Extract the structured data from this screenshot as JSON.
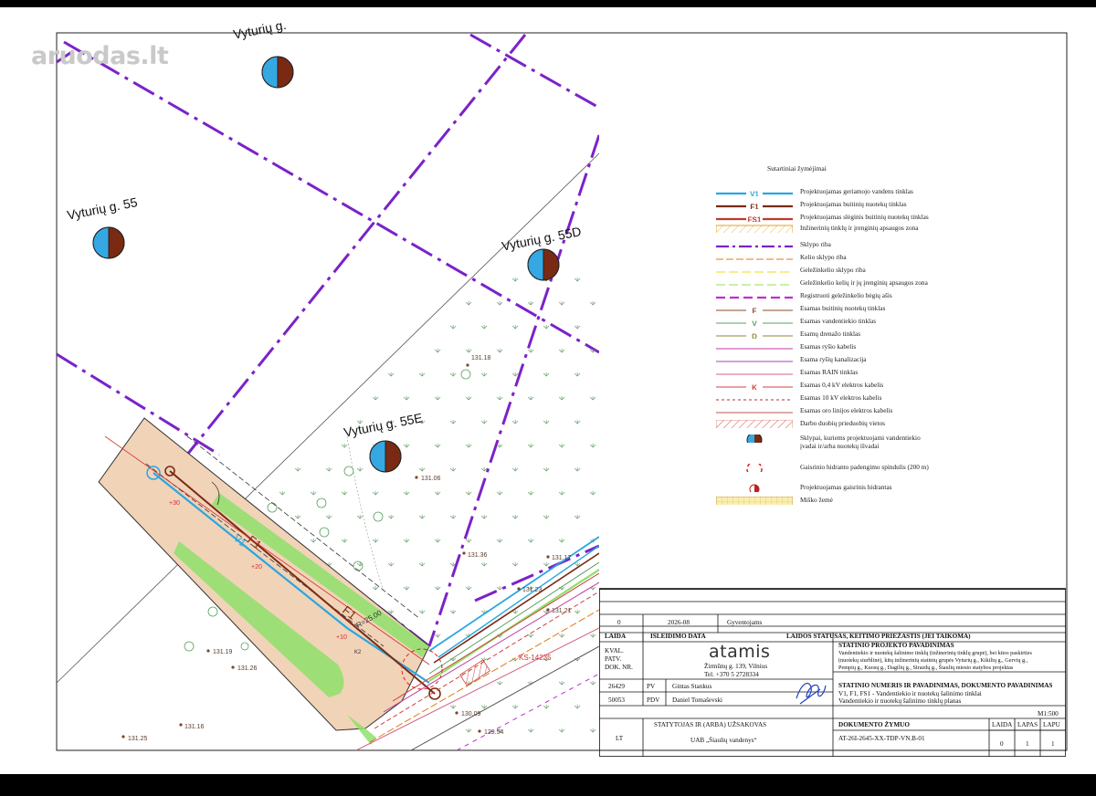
{
  "watermark": "aruodas.lt",
  "plot_labels": [
    {
      "id": "top",
      "text": "Vyturių g."
    },
    {
      "id": "p55",
      "text": "Vyturių g. 55"
    },
    {
      "id": "p55d",
      "text": "Vyturių g. 55D"
    },
    {
      "id": "p55e",
      "text": "Vyturių g. 55E"
    }
  ],
  "elevations": [
    "131.18",
    "131.06",
    "131.36",
    "131.17",
    "131.23",
    "131.21",
    "131.19",
    "131.26",
    "131.16",
    "131.25",
    "129.54",
    "130.09"
  ],
  "map_annotations": [
    "F1",
    "F1",
    "V1",
    "+20",
    "+30",
    "+10",
    "K2",
    "KS-14235",
    "R=25.00"
  ],
  "legend": {
    "title": "Sutartiniai žymėjimai",
    "items": [
      {
        "text": "Projektuojamas geriamojo vandens tinklas",
        "code": "V1",
        "color": "#2aa6e0"
      },
      {
        "text": "Projektuojamas buitinių nuotekų tinklas",
        "code": "F1",
        "color": "#7a2a12"
      },
      {
        "text": "Projektuojamas slėginis buitinių nuotekų tinklas",
        "code": "FS1",
        "color": "#c0392b"
      },
      {
        "text": "Inžinerinių tinklų ir įrenginių apsaugos zona",
        "code": "",
        "color": "#e8a020"
      },
      {
        "text": "Sklypo riba",
        "code": "",
        "color": "#7b22c9"
      },
      {
        "text": "Kelio sklypo riba",
        "code": "",
        "color": "#e07b1a"
      },
      {
        "text": "Geležinkelio sklypo riba",
        "code": "",
        "color": "#f0d81e"
      },
      {
        "text": "Geležinkelio kelių ir jų įrenginių apsaugos zona",
        "code": "",
        "color": "#8fe05a"
      },
      {
        "text": "Registruoti geležinkelio bėgių ašis",
        "code": "",
        "color": "#c22bd6"
      },
      {
        "text": "Esamas buitinių nuotekų tinklas",
        "code": "F",
        "color": "#8a4a2a"
      },
      {
        "text": "Esamas vandentiekio tinklas",
        "code": "V",
        "color": "#5aa060"
      },
      {
        "text": "Esamų drenažo tinklas",
        "code": "D",
        "color": "#8a8a3a"
      },
      {
        "text": "Esamas ryšio kabelis",
        "code": "",
        "color": "#c03aa0"
      },
      {
        "text": "Esama ryšių kanalizacija",
        "code": "",
        "color": "#a040c0"
      },
      {
        "text": "Esamas RAIN tinklas",
        "code": "",
        "color": "#d06080"
      },
      {
        "text": "Esamas 0,4 kV elektros kabelis",
        "code": "K",
        "color": "#d04040"
      },
      {
        "text": "Esamas 10 kV elektros kabelis",
        "code": "",
        "color": "#b03030"
      },
      {
        "text": "Esamas oro linijos elektros kabelis",
        "code": "",
        "color": "#c05050"
      },
      {
        "text": "Darbo duobių prieduobių vietos",
        "code": "",
        "color": "#e0908a"
      },
      {
        "text": "Sklypai, kuriems projektuojami vandentiekio",
        "text2": "įvadai ir/arba nuotekų išvadai",
        "code": "",
        "color": "#2aa6e0"
      },
      {
        "text": "Gaisrinio hidranto padengimo spindulis (200 m)",
        "code": "",
        "color": "#e02020"
      },
      {
        "text": "Projektuojamas gaisrinis hidrantas",
        "code": "",
        "color": "#e02020"
      },
      {
        "text": "Miško žemė",
        "code": "",
        "color": "#e8d070"
      }
    ]
  },
  "title_block": {
    "rev_num": "0",
    "rev_date": "2026-08",
    "rev_reason": "Gyventojams",
    "h_laida": "LAIDA",
    "h_date": "IŠLEIDIMO DATA",
    "h_status": "LAIDOS STATUSAS, KEITIMO PRIEŽASTIS (JEI TAIKOMA)",
    "kval": [
      "KVAL.",
      "PATV.",
      "DOK. NR."
    ],
    "company": "atamis",
    "company_addr": "Žirmūnų g. 139, Vilnius",
    "company_tel": "Tel. +370 5 2728334",
    "proj_h": "STATINIO PROJEKTO PAVADINIMAS",
    "proj_text": [
      "Vandentiekio ir nuotekų šalinimo tinklų (inžinerinių tinklų grupė), bei kitos paskirties",
      "(nuotekų siurblinė), kitų inžinerinių statinių grupės Vyturių g., Kikilių g., Gervių g.,",
      "Pempių g., Kuosų g., Dagilių g., Strazdų g., Šiaulių miesto statybos projektas"
    ],
    "p1_num": "26429",
    "p1_role": "PV",
    "p1_name": "Gintas Stankus",
    "p2_num": "50053",
    "p2_role": "PDV",
    "p2_name": "Daniel Tomaševski",
    "stat_h": "STATINIO NUMERIS IR PAVADINIMAS, DOKUMENTO PAVADINIMAS",
    "stat_1": "V1, F1, FS1 - Vandentiekio ir nuotekų šalinimo tinklai",
    "stat_2": "Vandentiekio ir nuotekų šalinimo tinklų planas",
    "scale": "M1:500",
    "owner_h": "STATYTOJAS IR (ARBA) UŽSAKOVAS",
    "owner": "UAB „Šiaulių vandenys“",
    "lt": "LT",
    "doc_h": "DOKUMENTO ŽYMUO",
    "doc_code": "AT-26I-2645-XX-TDP-VN.B-01",
    "h_laida2": "LAIDA",
    "h_lapas": "LAPAS",
    "h_lapu": "LAPU",
    "laida_val": "0",
    "lapas_val": "1",
    "lapu_val": "1"
  }
}
